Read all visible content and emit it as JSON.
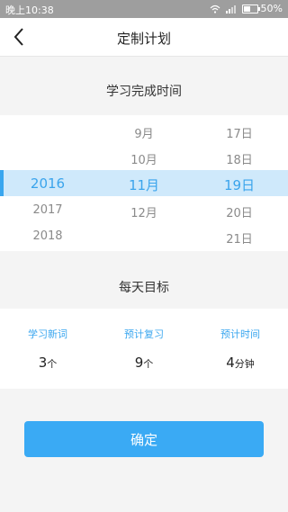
{
  "status_bar": {
    "time": "晚上10:38",
    "battery_text": "50%",
    "battery_level": 0.5,
    "icons": [
      "wifi-icon",
      "signal-icon",
      "battery-icon"
    ]
  },
  "nav": {
    "back_icon": "chevron-left-icon",
    "title": "定制计划"
  },
  "completion": {
    "title": "学习完成时间",
    "years": [
      "",
      "",
      "2016",
      "2017",
      "2018"
    ],
    "months": [
      "9月",
      "10月",
      "11月",
      "12月",
      ""
    ],
    "days": [
      "17日",
      "18日",
      "19日",
      "20日",
      "21日"
    ],
    "selected": {
      "year": "2016",
      "month": "11月",
      "day": "19日"
    }
  },
  "daily_goal": {
    "title": "每天目标",
    "items": [
      {
        "label": "学习新词",
        "value": "3",
        "unit": "个"
      },
      {
        "label": "预计复习",
        "value": "9",
        "unit": "个"
      },
      {
        "label": "预计时间",
        "value": "4",
        "unit": "分钟"
      }
    ]
  },
  "confirm_label": "确定",
  "colors": {
    "accent": "#3aaaf4",
    "selected_band": "#cfe9fb",
    "status_bar": "#9e9e9e"
  }
}
